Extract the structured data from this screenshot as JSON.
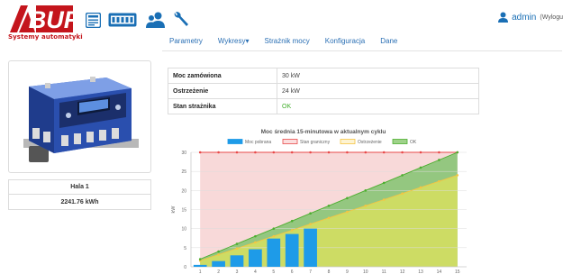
{
  "header": {
    "logo_text": "ABUR",
    "logo_subtitle": "Systemy automatyki",
    "icons": [
      "list-icon",
      "meter-icon",
      "users-icon",
      "wrench-icon"
    ],
    "user_name": "admin",
    "logout_label": "(Wylogu"
  },
  "nav": {
    "items": [
      "Parametry",
      "Wykresy▾",
      "Strażnik mocy",
      "Konfiguracja",
      "Dane"
    ]
  },
  "device": {
    "name": "Hala 1",
    "energy": "2241.76 kWh"
  },
  "status": {
    "rows": [
      {
        "label": "Moc zamówiona",
        "value": "30 kW"
      },
      {
        "label": "Ostrzeżenie",
        "value": "24 kW"
      },
      {
        "label": "Stan strażnika",
        "value": "OK"
      }
    ]
  },
  "colors": {
    "brand_red": "#c4151c",
    "link_blue": "#2a6fb4",
    "bar_blue": "#1e9be8",
    "limit_red": "#e84a4a",
    "warn_yellow": "#f5c542",
    "ok_green": "#4cae2f"
  },
  "chart_data": {
    "type": "bar",
    "title": "Moc średnia 15-minutowa w aktualnym cyklu",
    "ylabel": "kW",
    "xlabel": "",
    "ylim": [
      0,
      30
    ],
    "yticks": [
      0,
      5,
      10,
      15,
      20,
      25,
      30
    ],
    "x": [
      1,
      2,
      3,
      4,
      5,
      6,
      7,
      8,
      9,
      10,
      11,
      12,
      13,
      14,
      15
    ],
    "grid": true,
    "legend_position": "top",
    "series": [
      {
        "name": "Moc pobrana",
        "type": "bar",
        "color": "#1e9be8",
        "values": [
          0.5,
          1.5,
          3,
          4.6,
          7.4,
          8.6,
          10,
          null,
          null,
          null,
          null,
          null,
          null,
          null,
          null
        ]
      },
      {
        "name": "Stan graniczny",
        "type": "line",
        "color": "#e84a4a",
        "values": [
          30,
          30,
          30,
          30,
          30,
          30,
          30,
          30,
          30,
          30,
          30,
          30,
          30,
          30,
          30
        ]
      },
      {
        "name": "Ostrzeżenie",
        "type": "line",
        "color": "#f5c542",
        "values": [
          1.6,
          3.2,
          4.8,
          6.4,
          8,
          9.6,
          11.2,
          12.8,
          14.4,
          16,
          17.6,
          19.2,
          20.8,
          22.4,
          24
        ]
      },
      {
        "name": "OK",
        "type": "line",
        "color": "#4cae2f",
        "values": [
          2,
          4,
          6,
          8,
          10,
          12,
          14,
          16,
          18,
          20,
          22,
          24,
          26,
          28,
          30
        ]
      }
    ]
  }
}
